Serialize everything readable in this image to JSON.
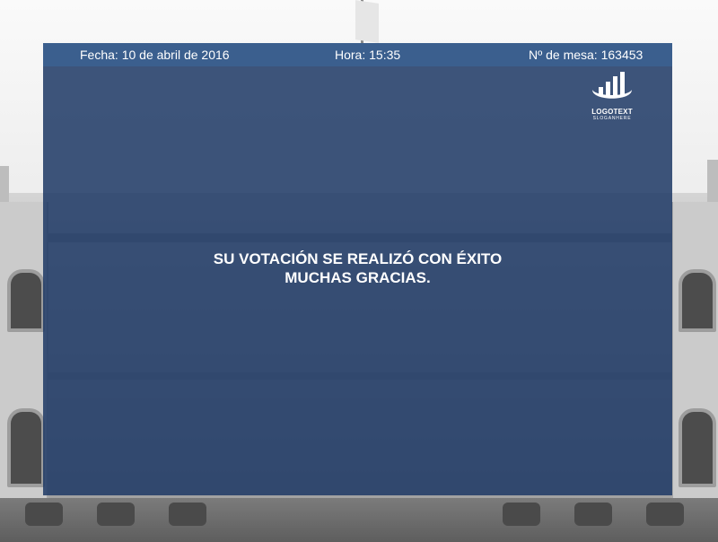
{
  "header": {
    "date_text": "Fecha: 10 de abril de 2016",
    "time_text": "Hora: 15:35",
    "table_text": "Nº de mesa: 163453"
  },
  "logo": {
    "icon": "bar-chart-swoosh-icon",
    "text": "LOGOTEXT",
    "slogan": "SLOGANHERE"
  },
  "message": {
    "line1": "SU VOTACIÓN SE REALIZÓ CON ÉXITO",
    "line2": "MUCHAS GRACIAS."
  },
  "colors": {
    "panel": "#1e3965",
    "header_bar": "#3b5f8e",
    "text": "#ffffff"
  }
}
